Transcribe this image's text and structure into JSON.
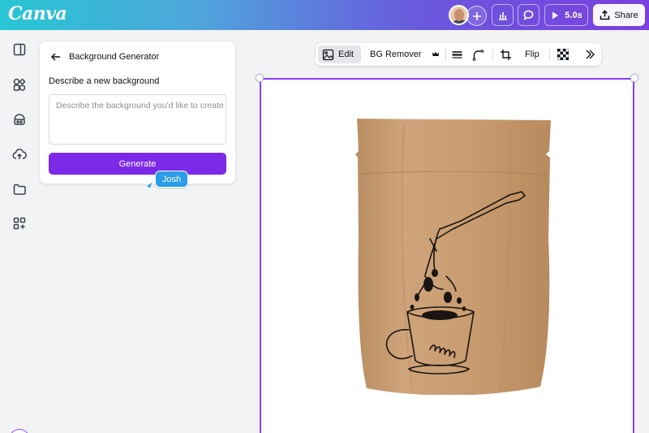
{
  "app": {
    "logo": "Canva"
  },
  "topbar": {
    "timer_label": "5.0s",
    "share_label": "Share"
  },
  "panel": {
    "title": "Background Generator",
    "field_label": "Describe a new background",
    "placeholder": "Describe the background you'd like to create",
    "generate_label": "Generate"
  },
  "collaborator": {
    "name": "Josh",
    "color": "#2a9ce8"
  },
  "toolbar": {
    "edit_label": "Edit",
    "bg_remover_label": "BG Remover",
    "flip_label": "Flip"
  },
  "colors": {
    "accent": "#7d2ae8",
    "selection": "#8b3dff",
    "gradient_start": "#27c6d3",
    "gradient_end": "#7b3fe0",
    "kraft": "#c79c72"
  }
}
